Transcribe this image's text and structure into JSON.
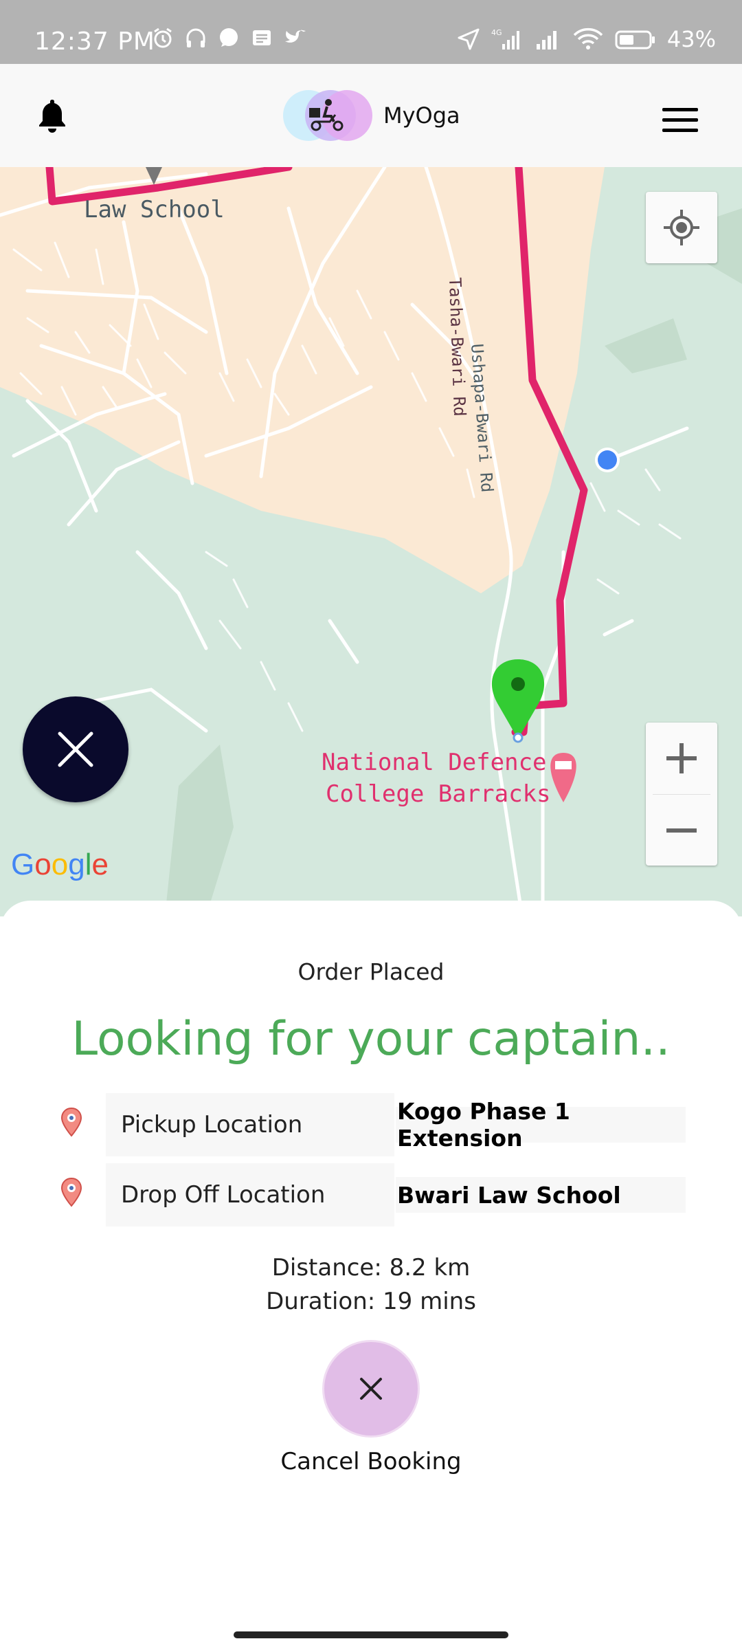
{
  "status_bar": {
    "time": "12:37 PM",
    "battery_text": "43%",
    "icons": [
      "alarm-icon",
      "headphones-icon",
      "whatsapp-icon",
      "message-icon",
      "twitter-icon",
      "location-arrow-icon",
      "signal-4g-icon",
      "signal-icon",
      "wifi-icon",
      "battery-icon"
    ]
  },
  "header": {
    "brand_name": "MyOga",
    "left_icon": "bell-icon",
    "right_icon": "menu-icon"
  },
  "map": {
    "labels": {
      "law_school": "Law School",
      "tasha_road": "Tasha-Bwari Rd",
      "ushapa_road": "Ushapa-Bwari Rd",
      "defence_line1": "National Defence",
      "defence_line2": "College Barracks"
    },
    "attribution": "Google",
    "route_color": "#e0246a",
    "zoom_in": "+",
    "zoom_out": "−"
  },
  "order": {
    "status": "Order Placed",
    "headline": "Looking for your captain..",
    "pickup_label": "Pickup Location",
    "pickup_value": "Kogo Phase 1 Extension",
    "dropoff_label": "Drop Off Location",
    "dropoff_value": "Bwari Law School",
    "distance": "Distance: 8.2 km",
    "duration": "Duration: 19 mins",
    "cancel_label": "Cancel Booking"
  },
  "colors": {
    "accent_green": "#4caa58",
    "cancel_bg": "#e1bde7",
    "fab_bg": "#0a0a2c"
  }
}
